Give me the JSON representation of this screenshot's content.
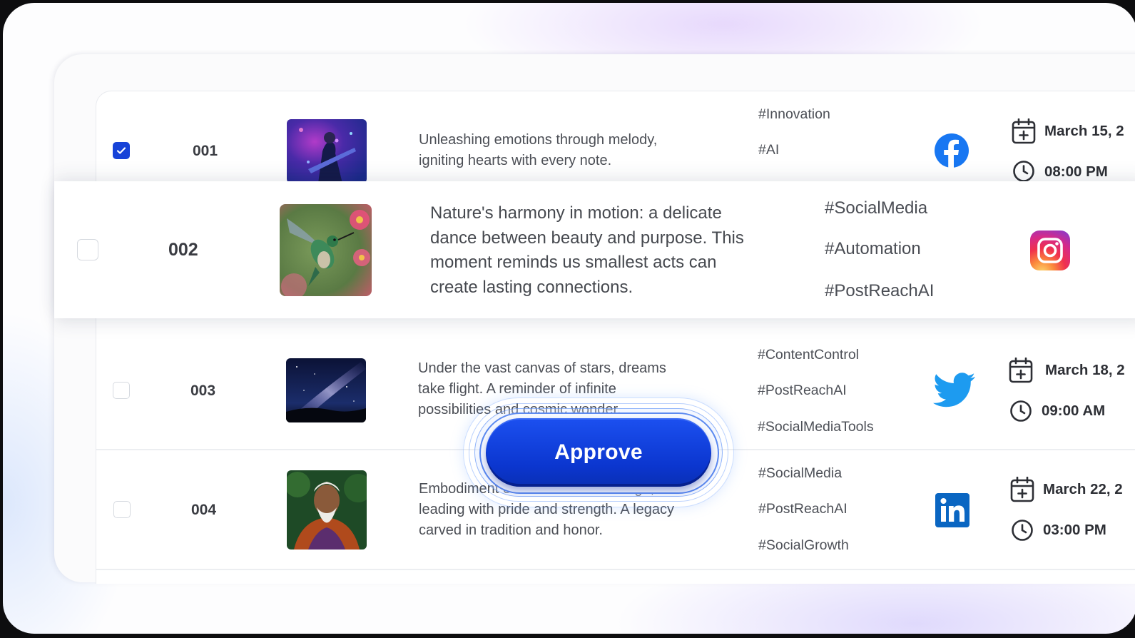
{
  "colors": {
    "accent": "#1743d8",
    "approve": "#0b3ad6",
    "facebook": "#1877f2",
    "twitter": "#1d9bf0",
    "linkedin": "#0a66c2"
  },
  "rows": [
    {
      "id": "001",
      "checked": true,
      "image": "guitarist-neon-image",
      "text_line1": "Unleashing emotions through melody,",
      "text_line2": "igniting hearts with every note.",
      "tags": [
        "#Innovation",
        "#AI"
      ],
      "platform": "facebook-icon",
      "date": "March 15, 2",
      "time": "08:00 PM"
    },
    {
      "id": "002",
      "checked": false,
      "image": "hummingbird-image",
      "text_line1": "Nature's harmony in motion: a delicate",
      "text_line2": "dance between beauty and purpose. This",
      "text_line3": "moment reminds us smallest acts can",
      "text_line4": "create lasting connections.",
      "tags": [
        "#SocialMedia",
        "#Automation",
        "#PostReachAI"
      ],
      "platform": "instagram-icon"
    },
    {
      "id": "003",
      "checked": false,
      "image": "milky-way-image",
      "text_line1": "Under the vast canvas of stars, dreams",
      "text_line2": "take flight. A reminder of infinite",
      "text_line3": "possibilities and cosmic wonder.",
      "tags": [
        "#ContentControl",
        "#PostReachAI",
        "#SocialMediaTools"
      ],
      "platform": "twitter-icon",
      "date": "March 18, 2",
      "time": "09:00 AM"
    },
    {
      "id": "004",
      "checked": false,
      "image": "elder-portrait-image",
      "text_line1": "Embodiment of wisdom and heritage,",
      "text_line2": "leading with pride and strength. A legacy",
      "text_line3": "carved in tradition and honor.",
      "tags": [
        "#SocialMedia",
        "#PostReachAI",
        "#SocialGrowth"
      ],
      "platform": "linkedin-icon",
      "date": "March 22, 2",
      "time": "03:00 PM"
    }
  ],
  "approve_button": {
    "label": "Approve"
  }
}
